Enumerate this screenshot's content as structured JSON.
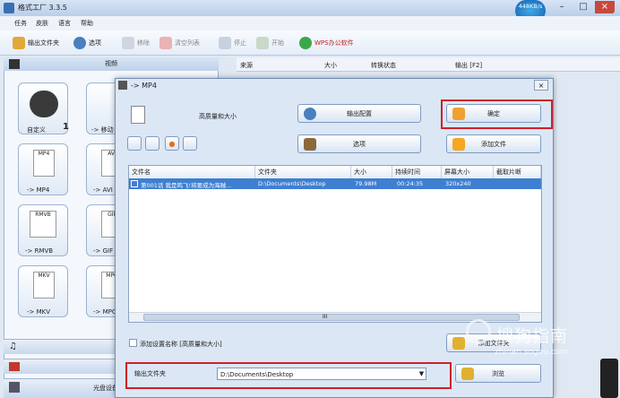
{
  "app": {
    "title": "格式工厂 3.3.5",
    "speed": "448KB/s"
  },
  "menu": [
    "任务",
    "皮肤",
    "语言",
    "帮助"
  ],
  "toolbar": {
    "output_folder": "输出文件夹",
    "options": "选项",
    "remove": "移除",
    "clear_list": "清空列表",
    "stop": "停止",
    "start": "开始",
    "wps": "WPS办公软件"
  },
  "left_panel": {
    "header": "视频",
    "tiles": [
      {
        "label": "自定义",
        "badge": "1"
      },
      {
        "label": "-> 移动"
      },
      {
        "label": "-> MP4",
        "icon_text": "MP4"
      },
      {
        "label": "-> AVI",
        "icon_text": "AVI"
      },
      {
        "label": "-> RMVB",
        "icon_text": "RMVB"
      },
      {
        "label": "-> GIF",
        "icon_text": "GIF"
      },
      {
        "label": "-> MKV",
        "icon_text": "MKV"
      },
      {
        "label": "-> MPG",
        "icon_text": "MPG"
      }
    ],
    "bottom_bar": "光盘设备"
  },
  "list_header": {
    "source": "来源",
    "size": "大小",
    "status": "转换状态",
    "output": "输出 [F2]"
  },
  "dialog": {
    "title": "-> MP4",
    "close": "×",
    "quality": "高质量和大小",
    "output_config": "输出配置",
    "ok": "确定",
    "options": "选项",
    "add_file": "添加文件",
    "columns": [
      "文件名",
      "文件夹",
      "大小",
      "持续时间",
      "屏幕大小",
      "截取片断"
    ],
    "rows": [
      {
        "name": "第001话 我是鸣飞!将要成为海贼...",
        "folder": "D:\\Documents\\Desktop",
        "size": "79.98M",
        "duration": "00:24:35",
        "screen": "320x240"
      }
    ],
    "scroll_mark": "III",
    "add_setting_name": "添加设置名称 [高质量和大小]",
    "add_folder": "添加文件夹",
    "output_folder_label": "输出文件夹",
    "output_folder_value": "D:\\Documents\\Desktop",
    "browse": "浏览"
  },
  "watermark": {
    "text": "搜狗指南",
    "sub": "zhinan.sogou.com"
  },
  "colors": {
    "highlight_box": "#d01f2a",
    "selected_row": "#3f7fd1"
  }
}
